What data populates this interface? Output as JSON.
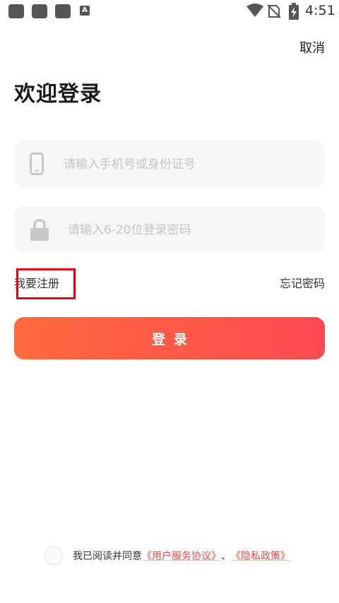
{
  "status_bar": {
    "time": "4:51",
    "a_icon_label": "A"
  },
  "header": {
    "cancel_label": "取消"
  },
  "page": {
    "title": "欢迎登录"
  },
  "form": {
    "phone_placeholder": "请输入手机号或身份证号",
    "phone_value": "",
    "password_placeholder": "请输入6-20位登录密码",
    "password_value": ""
  },
  "links": {
    "register_label": "我要注册",
    "forgot_label": "忘记密码"
  },
  "login_button": {
    "label": "登录"
  },
  "agreement": {
    "prefix": "我已阅读并同意",
    "user_agreement": "《用户服务协议》",
    "separator": "、",
    "privacy_policy": "《隐私政策》"
  },
  "colors": {
    "accent_start": "#ff6a3d",
    "accent_end": "#ff4a53",
    "link": "#ea4a4a",
    "highlight": "#e60012"
  },
  "icons": {
    "phone_field": "smartphone-icon",
    "password_field": "lock-icon"
  }
}
